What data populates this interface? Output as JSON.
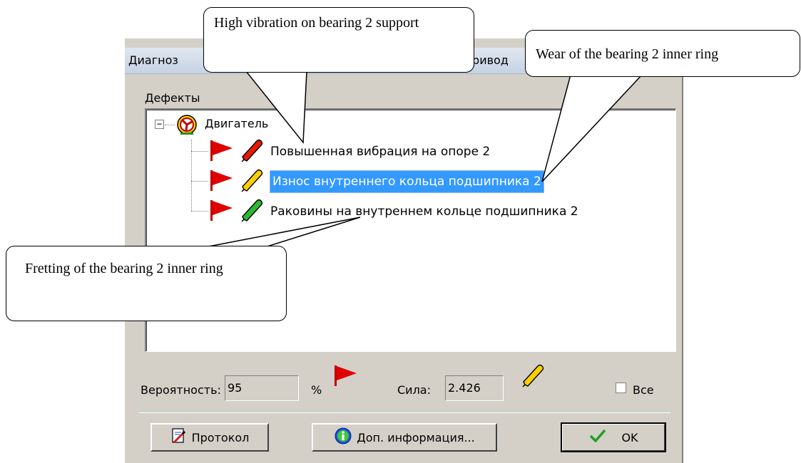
{
  "window": {
    "title_left": "Диагноз",
    "title_right": "Привод"
  },
  "defects_group": {
    "label": "Дефекты",
    "root": {
      "label": "Двигатель",
      "expander": "−"
    },
    "items": [
      {
        "label": "Повышенная вибрация на опоре 2",
        "severity_color": "#e81b00",
        "selected": false
      },
      {
        "label": "Износ внутреннего кольца подшипника 2",
        "severity_color": "#ffd000",
        "selected": true
      },
      {
        "label": "Раковины на внутреннем кольце подшипника 2",
        "severity_color": "#2fb82f",
        "selected": false
      }
    ]
  },
  "status": {
    "probability_label": "Вероятность:",
    "probability_value": "95",
    "percent_sign": "%",
    "strength_label": "Сила:",
    "strength_value": "2.426",
    "all_checkbox_label": "Все",
    "all_checked": false
  },
  "buttons": {
    "protocol": "Протокол",
    "more_info": "Доп. информация...",
    "ok": "OK"
  },
  "callouts": {
    "vibration": "High vibration on bearing 2 support",
    "wear": "Wear of the bearing 2 inner ring",
    "fretting": "Fretting of the bearing 2 inner ring"
  },
  "colors": {
    "flag": "#e00000",
    "selection": "#3399ff",
    "dialog_bg": "#d4d0c8"
  },
  "icons": {
    "root": "motor-icon",
    "flag": "red-flag-icon",
    "pencil": "pencil-icon",
    "protocol": "report-icon",
    "info": "info-icon",
    "ok": "checkmark-icon"
  }
}
